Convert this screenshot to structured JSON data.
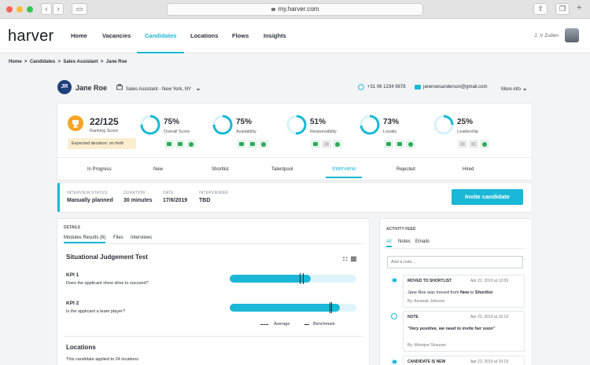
{
  "browser": {
    "url": "my.harver.com"
  },
  "app": {
    "logo": "harver",
    "nav": [
      "Home",
      "Vacancies",
      "Candidates",
      "Locations",
      "Flows",
      "Insights"
    ],
    "active_nav": "Candidates",
    "user": "J. V Zuilen"
  },
  "breadcrumb": [
    "Home",
    ">",
    "Candidates",
    ">",
    "Sales Assistant",
    ">",
    "Jane Roe"
  ],
  "candidate": {
    "initials": "JR",
    "name": "Jane Roe",
    "job": "Sales Assistant - New York, NY",
    "phone": "+31 06 1234 5678",
    "email": "janeroesanderson@gmail.com",
    "more_info": "More info"
  },
  "ranking": {
    "value": "22/125",
    "label": "Ranking Score",
    "decision": "Expected decision: on hold"
  },
  "scores": [
    {
      "pct": "75%",
      "label": "Overall Score",
      "value": 0.75
    },
    {
      "pct": "75%",
      "label": "Availability",
      "value": 0.75
    },
    {
      "pct": "51%",
      "label": "Responsibility",
      "value": 0.51
    },
    {
      "pct": "73%",
      "label": "Loyalty",
      "value": 0.73
    },
    {
      "pct": "25%",
      "label": "Leadership",
      "value": 0.25
    }
  ],
  "stages": [
    "In Progress",
    "New",
    "Shortlist",
    "Talentpool",
    "Interview",
    "Rejected",
    "Hired"
  ],
  "active_stage": "Interview",
  "interview": {
    "status_label": "INTERVIEW STATUS:",
    "status": "Manually planned",
    "duration_label": "DURATION:",
    "duration": "30 minutes",
    "date_label": "DATE:",
    "date": "17/6/2019",
    "interviewer_label": "INTERVIEWER:",
    "interviewer": "TBD",
    "invite_button": "Invite candidate"
  },
  "details": {
    "title": "DETAILS",
    "tabs": [
      "Modules Results (6)",
      "Files",
      "Interviews"
    ],
    "section": "Situational Judgement Test",
    "kpis": [
      {
        "title": "KPI 1",
        "question": "Does the applicant show drive to succeed?",
        "score": 0.64,
        "average": 0.55,
        "benchmark": 0.58
      },
      {
        "title": "KPI 2",
        "question": "Is the applicant a team player?",
        "score": 0.87,
        "average": 0.8,
        "benchmark": 0.79
      }
    ],
    "legend_average": "Average",
    "legend_benchmark": "Benchmark",
    "locations_title": "Locations",
    "locations_sub": "This candidate applied to 24 locations"
  },
  "activity": {
    "title": "ACTIVITY FEED",
    "tabs": [
      "All",
      "Notes",
      "Emails"
    ],
    "placeholder": "Add a note...",
    "items": [
      {
        "title": "MOVED TO SHORTLIST",
        "date": "Apr 22, 2019 at 12:09",
        "body_prefix": "Jane Roe was moved from ",
        "body_from": "New",
        "body_mid": " to ",
        "body_to": "Shortlist",
        "by": "By: Amanda Johnson"
      },
      {
        "title": "NOTE",
        "date": "Apr 22, 2019 at 10:19",
        "body": "\"Very positive, we need to invite her soon\"",
        "by": "By: Monique Strausse"
      },
      {
        "title": "CANDIDATE IS NEW",
        "date": "Apr 22, 2019 at 10:19"
      }
    ]
  },
  "colors": {
    "accent": "#1ab8d6",
    "green": "#2faa5d",
    "trophy": "#f5a623",
    "avatar_bg": "#1f3f7a"
  }
}
